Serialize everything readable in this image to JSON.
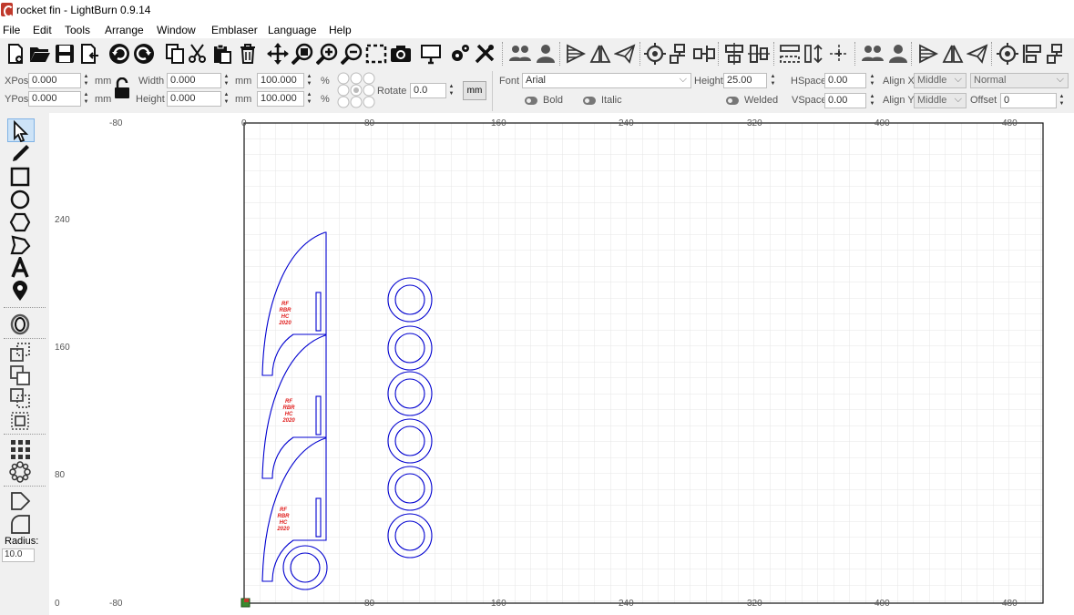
{
  "window": {
    "title": "rocket fin - LightBurn 0.9.14"
  },
  "menu": [
    "File",
    "Edit",
    "Tools",
    "Arrange",
    "Window",
    "Emblaser",
    "Language",
    "Help"
  ],
  "toolbar_icons": [
    "new-file-icon",
    "open-folder-icon",
    "save-icon",
    "import-icon",
    "undo-icon",
    "redo-icon",
    "copy-icon",
    "cut-icon",
    "paste-icon",
    "delete-icon",
    "move-icon",
    "zoom-fit-icon",
    "zoom-in-icon",
    "zoom-out-icon",
    "select-frame-icon",
    "camera-icon",
    "device-monitor-icon",
    "settings-gears-icon",
    "tools-wrench-icon",
    "group-icon",
    "user-icon",
    "align-left-icon",
    "mirror-icon",
    "send-icon",
    "target-icon",
    "distribute-h-icon",
    "distribute-v-icon",
    "align-center-icon",
    "align-middle-icon",
    "align-h-icon",
    "align-gap-icon",
    "center-icon",
    "group2-icon",
    "user2-icon",
    "flip-h-icon",
    "mirror2-icon",
    "send2-icon",
    "target2-icon",
    "align-left2-icon",
    "distribute2-icon"
  ],
  "properties": {
    "xpos_label": "XPos",
    "xpos": "0.000",
    "ypos_label": "YPos",
    "ypos": "0.000",
    "unit": "mm",
    "width_label": "Width",
    "width": "0.000",
    "height_label": "Height",
    "height": "0.000",
    "scale_w": "100.000",
    "scale_h": "100.000",
    "percent": "%",
    "rotate_label": "Rotate",
    "rotate": "0.0",
    "mm_button": "mm",
    "font_label": "Font",
    "font": "Arial",
    "text_height_label": "Height",
    "text_height": "25.00",
    "hspace_label": "HSpace",
    "hspace": "0.00",
    "vspace_label": "VSpace",
    "vspace": "0.00",
    "align_x_label": "Align X",
    "align_x": "Middle",
    "align_y_label": "Align Y",
    "align_y": "Middle",
    "normal": "Normal",
    "offset_label": "Offset",
    "offset": "0",
    "bold": "Bold",
    "italic": "Italic",
    "welded": "Welded"
  },
  "left_tools": [
    "select-arrow-icon",
    "pen-icon",
    "rectangle-icon",
    "ellipse-icon",
    "polygon-icon",
    "freeform-icon",
    "text-icon",
    "position-pin-icon",
    "offset-icon",
    "boolean-union-icon",
    "boolean-subtract-icon",
    "boolean-intersect-icon",
    "weld-icon",
    "grid-array-icon",
    "circular-array-icon",
    "edit-nodes-icon",
    "corner-radius-icon"
  ],
  "radius": {
    "label": "Radius:",
    "value": "10.0"
  },
  "rulers": {
    "top": [
      "-80",
      "0",
      "80",
      "160",
      "240",
      "320",
      "400",
      "480"
    ],
    "left": [
      "240",
      "160",
      "80",
      "0"
    ],
    "bottom": [
      "-80",
      "80",
      "160",
      "240",
      "320",
      "400",
      "480"
    ]
  },
  "fin_label": [
    "RF",
    "RBR",
    "HC",
    "2020"
  ],
  "colors": {
    "accent_red": "#e0201f",
    "shape_blue": "#0000d0",
    "origin_green": "#3a8a2e",
    "grid": "#e2e2e2"
  }
}
